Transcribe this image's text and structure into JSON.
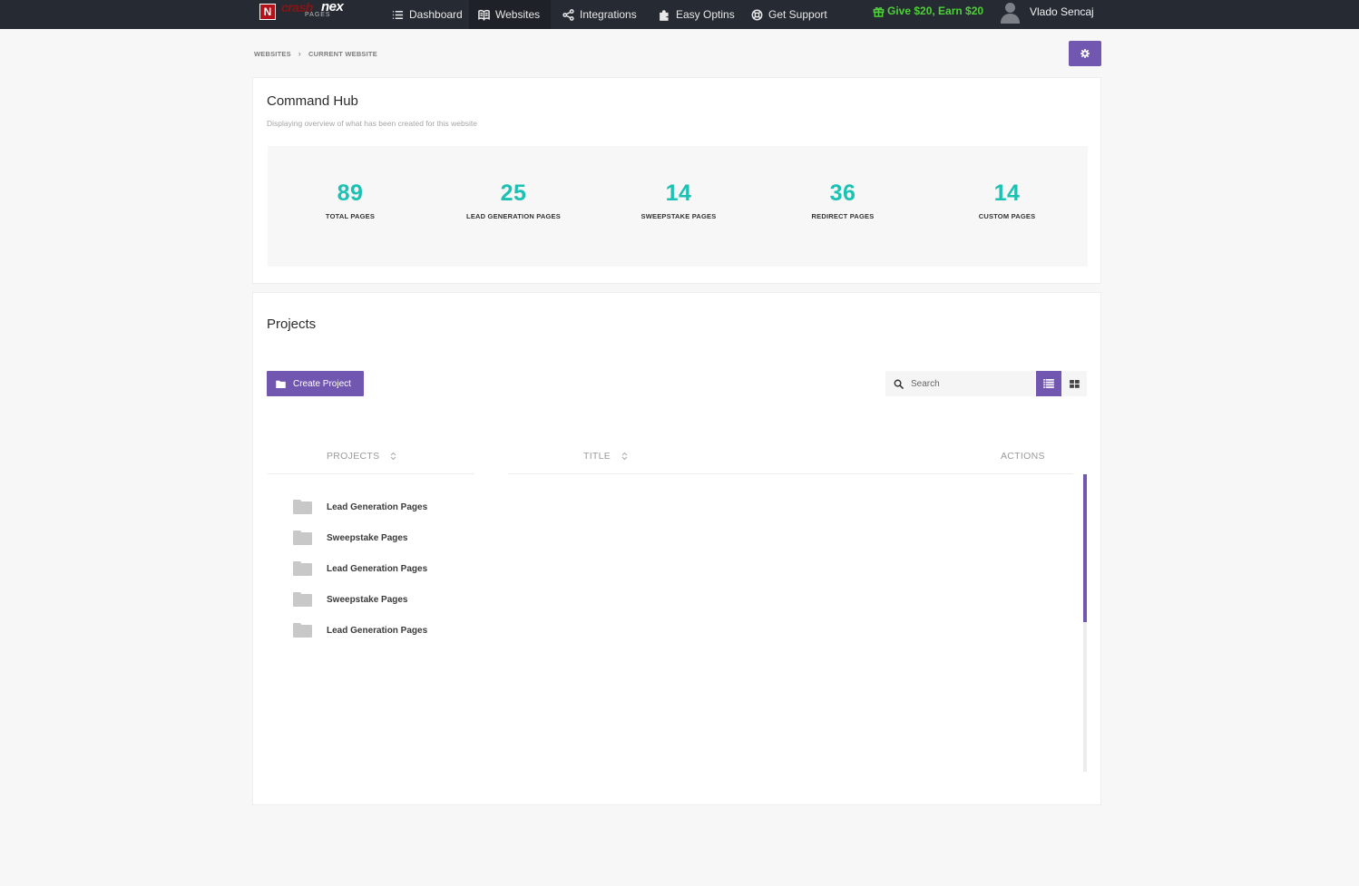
{
  "brand": {
    "word1": "crash",
    "word2": "nex",
    "sub": "PAGES",
    "mark": "N"
  },
  "nav": [
    {
      "label": "Dashboard",
      "icon": "list-icon"
    },
    {
      "label": "Websites",
      "icon": "book-icon",
      "active": true
    },
    {
      "label": "Integrations",
      "icon": "share-icon"
    },
    {
      "label": "Easy Optins",
      "icon": "puzzle-icon"
    },
    {
      "label": "Get Support",
      "icon": "lifebuoy-icon"
    }
  ],
  "promo": {
    "label": "Give $20, Earn $20",
    "icon": "gift-icon",
    "color": "#4cd137"
  },
  "user": {
    "name": "Vlado Sencaj"
  },
  "breadcrumb": {
    "root": "WEBSITES",
    "current": "CURRENT WEBSITE"
  },
  "hub": {
    "title": "Command Hub",
    "subtitle": "Displaying overview of what has been created for this website",
    "stats": [
      {
        "value": "89",
        "label": "TOTAL PAGES"
      },
      {
        "value": "25",
        "label": "LEAD GENERATION PAGES"
      },
      {
        "value": "14",
        "label": "SWEEPSTAKE PAGES"
      },
      {
        "value": "36",
        "label": "REDIRECT PAGES"
      },
      {
        "value": "14",
        "label": "CUSTOM PAGES"
      }
    ]
  },
  "projects": {
    "title": "Projects",
    "create_label": "Create Project",
    "search_placeholder": "Search",
    "columns": {
      "projects": "PROJECTS",
      "title": "TITLE",
      "actions": "ACTIONS"
    },
    "items": [
      "Lead Generation Pages",
      "Sweepstake Pages",
      "Lead Generation Pages",
      "Sweepstake Pages",
      "Lead Generation Pages"
    ]
  },
  "colors": {
    "accent": "#7257b0",
    "stat": "#1cc1b4",
    "navbar": "#262b33"
  }
}
